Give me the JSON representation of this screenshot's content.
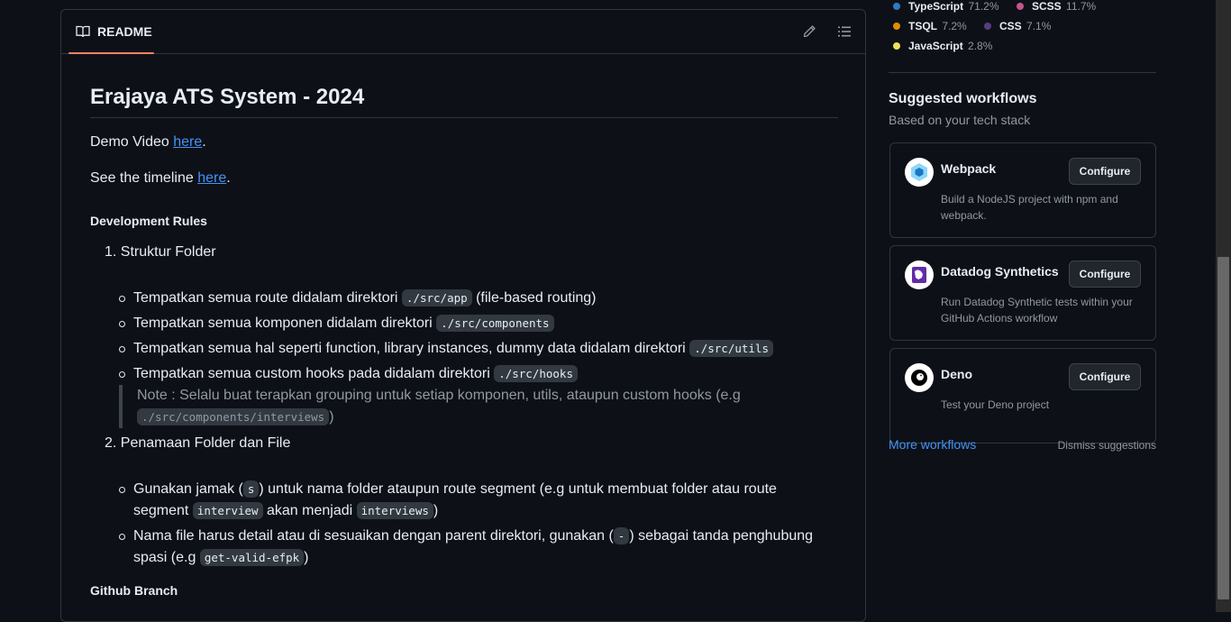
{
  "readme": {
    "tab_label": "README",
    "title": "Erajaya ATS System - 2024",
    "demo_prefix": "Demo Video ",
    "demo_link": "here",
    "demo_suffix": ".",
    "timeline_prefix": "See the timeline ",
    "timeline_link": "here",
    "timeline_suffix": ".",
    "dev_rules_heading": "Development Rules",
    "rule1_title": "1. Struktur Folder",
    "rule1_items": [
      {
        "text": "Tempatkan semua route didalam direktori ",
        "code": "./src/app",
        "suffix": " (file-based routing)"
      },
      {
        "text": "Tempatkan semua komponen didalam direktori ",
        "code": "./src/components",
        "suffix": ""
      },
      {
        "text": "Tempatkan semua hal seperti function, library instances, dummy data didalam direktori ",
        "code": "./src/utils",
        "suffix": ""
      },
      {
        "text": "Tempatkan semua custom hooks pada didalam direktori ",
        "code": "./src/hooks",
        "suffix": ""
      }
    ],
    "note_text": "Note : Selalu buat terapkan grouping untuk setiap komponen, utils, ataupun custom hooks (e.g",
    "note_code": "./src/components/interviews",
    "note_suffix": ")",
    "rule2_title": "2. Penamaan Folder dan File",
    "rule2_item1": {
      "a": "Gunakan jamak (",
      "code1": "s",
      "b": ") untuk nama folder ataupun route segment (e.g untuk membuat folder atau route segment ",
      "code2": "interview",
      "c": " akan menjadi ",
      "code3": "interviews",
      "d": ")"
    },
    "rule2_item2": {
      "a": "Nama file harus detail atau di sesuaikan dengan parent direktori, gunakan (",
      "code1": "-",
      "b": ") sebagai tanda penghubung spasi (e.g ",
      "code2": "get-valid-efpk",
      "c": ")"
    },
    "branch_heading": "Github Branch"
  },
  "languages": [
    {
      "name": "TypeScript",
      "pct": "71.2%",
      "color": "#3178c6"
    },
    {
      "name": "SCSS",
      "pct": "11.7%",
      "color": "#c6538c"
    },
    {
      "name": "TSQL",
      "pct": "7.2%",
      "color": "#e38c00"
    },
    {
      "name": "CSS",
      "pct": "7.1%",
      "color": "#563d7c"
    },
    {
      "name": "JavaScript",
      "pct": "2.8%",
      "color": "#f1e05a"
    }
  ],
  "suggested": {
    "title": "Suggested workflows",
    "subtitle": "Based on your tech stack",
    "configure_label": "Configure",
    "cards": [
      {
        "name": "Webpack",
        "desc": "Build a NodeJS project with npm and webpack.",
        "icon": "webpack-icon"
      },
      {
        "name": "Datadog Synthetics",
        "desc": "Run Datadog Synthetic tests within your GitHub Actions workflow",
        "icon": "datadog-icon"
      },
      {
        "name": "Deno",
        "desc": "Test your Deno project",
        "icon": "deno-icon"
      }
    ],
    "more_label": "More workflows",
    "dismiss_label": "Dismiss suggestions"
  }
}
